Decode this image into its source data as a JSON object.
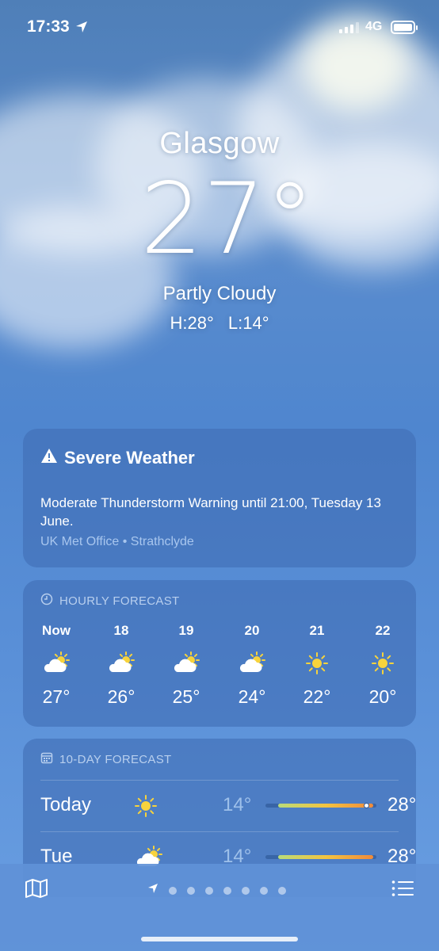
{
  "status": {
    "time": "17:33",
    "network": "4G"
  },
  "location": {
    "city": "Glasgow",
    "temperature": "27°",
    "condition": "Partly Cloudy",
    "high": "H:28°",
    "low": "L:14°"
  },
  "severe": {
    "title": "Severe Weather",
    "text": "Moderate Thunderstorm Warning until 21:00, Tuesday 13 June.",
    "source": "UK Met Office • Strathclyde"
  },
  "hourly": {
    "label": "HOURLY FORECAST",
    "items": [
      {
        "time": "Now",
        "icon": "partly-cloudy-icon",
        "temp": "27°"
      },
      {
        "time": "18",
        "icon": "partly-cloudy-icon",
        "temp": "26°"
      },
      {
        "time": "19",
        "icon": "partly-cloudy-icon",
        "temp": "25°"
      },
      {
        "time": "20",
        "icon": "partly-cloudy-icon",
        "temp": "24°"
      },
      {
        "time": "21",
        "icon": "sun-icon",
        "temp": "22°"
      },
      {
        "time": "22",
        "icon": "sun-icon",
        "temp": "20°"
      }
    ]
  },
  "daily": {
    "label": "10-DAY FORECAST",
    "days": [
      {
        "day": "Today",
        "icon": "sun-icon",
        "low": "14°",
        "high": "28°"
      },
      {
        "day": "Tue",
        "icon": "partly-cloudy-icon",
        "low": "14°",
        "high": "28°"
      }
    ]
  },
  "colors": {
    "accent": "#4f86cf",
    "warning_source": "#a8c6ee"
  }
}
